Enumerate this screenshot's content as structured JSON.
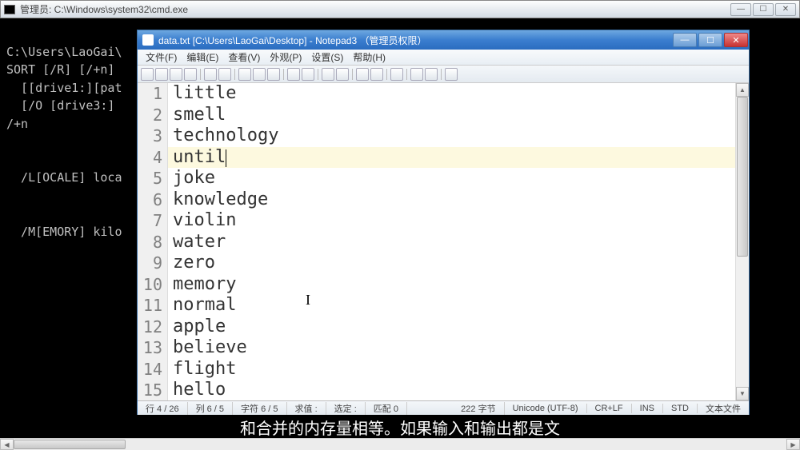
{
  "cmd": {
    "title": "管理员: C:\\Windows\\system32\\cmd.exe",
    "lines": [
      "C:\\Users\\LaoGai\\",
      "SORT [/R] [/+n]",
      "  [[drive1:][pat",
      "  [/O [drive3:]",
      "/+n",
      "",
      "",
      "  /L[OCALE] loca",
      "",
      "",
      "  /M[EMORY] kilo"
    ]
  },
  "notepad": {
    "title": "data.txt [C:\\Users\\LaoGai\\Desktop] - Notepad3 （管理员权限）",
    "menu": [
      "文件(F)",
      "编辑(E)",
      "查看(V)",
      "外观(P)",
      "设置(S)",
      "帮助(H)"
    ],
    "lines": [
      {
        "n": 1,
        "t": "little"
      },
      {
        "n": 2,
        "t": "smell"
      },
      {
        "n": 3,
        "t": "technology"
      },
      {
        "n": 4,
        "t": "until"
      },
      {
        "n": 5,
        "t": "joke"
      },
      {
        "n": 6,
        "t": "knowledge"
      },
      {
        "n": 7,
        "t": "violin"
      },
      {
        "n": 8,
        "t": "water"
      },
      {
        "n": 9,
        "t": "zero"
      },
      {
        "n": 10,
        "t": "memory"
      },
      {
        "n": 11,
        "t": "normal"
      },
      {
        "n": 12,
        "t": "apple"
      },
      {
        "n": 13,
        "t": "believe"
      },
      {
        "n": 14,
        "t": "flight"
      },
      {
        "n": 15,
        "t": "hello"
      }
    ],
    "current_line": 4,
    "status": {
      "row": "行 4 / 26",
      "col": "列 6 / 5",
      "char": "字符 6 / 5",
      "val": "求值 :",
      "sel": "选定 :",
      "match": "匹配 0",
      "bytes": "222 字节",
      "enc": "Unicode (UTF-8)",
      "eol": "CR+LF",
      "ins": "INS",
      "std": "STD",
      "type": "文本文件"
    }
  },
  "caption": "和合并的内存量相等。如果输入和输出都是文",
  "cursor_glyph": "I"
}
